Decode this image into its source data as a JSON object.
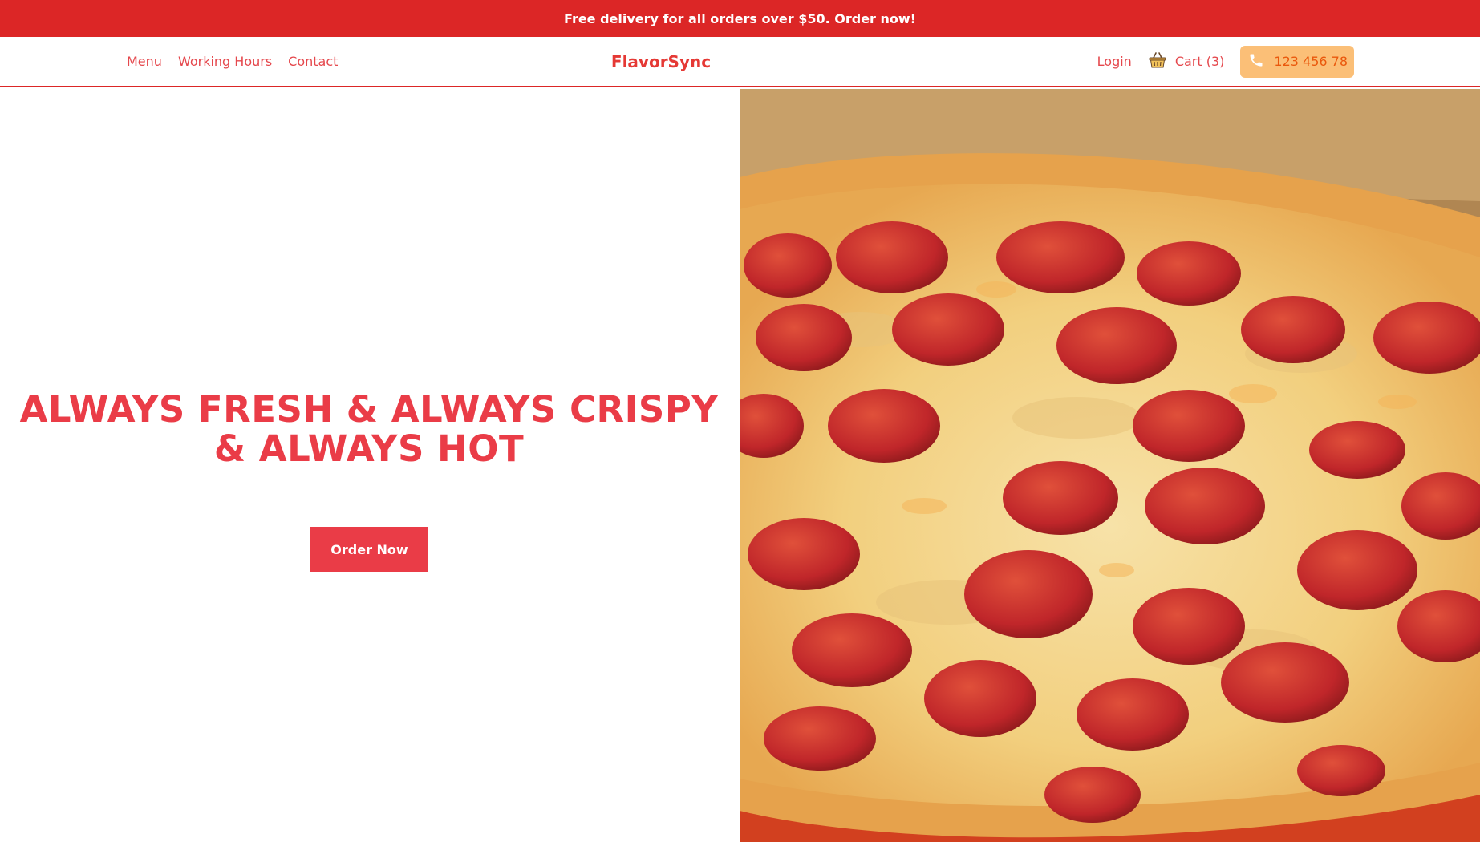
{
  "promo": {
    "text": "Free delivery for all orders over $50. Order now!"
  },
  "nav": {
    "links": [
      {
        "label": "Menu"
      },
      {
        "label": "Working Hours"
      },
      {
        "label": "Contact"
      }
    ],
    "brand": "FlavorSync",
    "login_label": "Login",
    "cart": {
      "icon": "basket-icon",
      "label": "Cart (3)"
    },
    "phone": {
      "icon": "phone-icon",
      "number": "123 456 78"
    }
  },
  "hero": {
    "title": "ALWAYS FRESH & ALWAYS CRISPY & ALWAYS HOT",
    "cta_label": "Order Now",
    "image": "pepperoni-pizza-photo"
  },
  "colors": {
    "brand_red": "#dc2626",
    "accent_red": "#ea3c47",
    "phone_bg": "#fbbf77",
    "phone_text": "#ea580c"
  }
}
